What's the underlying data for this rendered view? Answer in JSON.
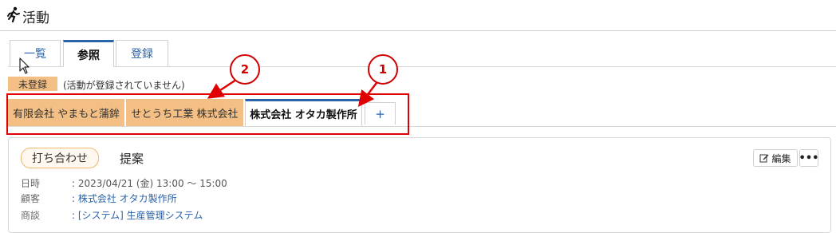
{
  "header": {
    "icon": "runner-icon",
    "title": "活動"
  },
  "tabs": [
    {
      "label": "一覧",
      "active": false
    },
    {
      "label": "参照",
      "active": true
    },
    {
      "label": "登録",
      "active": false
    }
  ],
  "status": {
    "badge": "未登録",
    "note": "(活動が登録されていません)",
    "badge_color": "#f3bf84"
  },
  "company_tabs": [
    {
      "label": "有限会社 やまもと蒲鉾",
      "active": false
    },
    {
      "label": "せとうち工業 株式会社",
      "active": false
    },
    {
      "label": "株式会社 オタカ製作所",
      "active": true
    },
    {
      "label": "+",
      "active": false
    }
  ],
  "callouts": {
    "one": "1",
    "two": "2"
  },
  "card": {
    "type_label": "打ち合わせ",
    "title": "提案",
    "edit_label": "編集",
    "more_label": "•••",
    "rows": [
      {
        "label": "日時",
        "value": ": 2023/04/21 (金) 13:00 ～ 15:00"
      },
      {
        "label": "顧客",
        "value": ": 株式会社 オタカ製作所"
      },
      {
        "label": "商談",
        "value": ": [システム] 生産管理システム"
      }
    ]
  },
  "colors": {
    "accent": "#2b63a8",
    "annotation": "#e00000",
    "tab_orange": "#f3bf84"
  }
}
